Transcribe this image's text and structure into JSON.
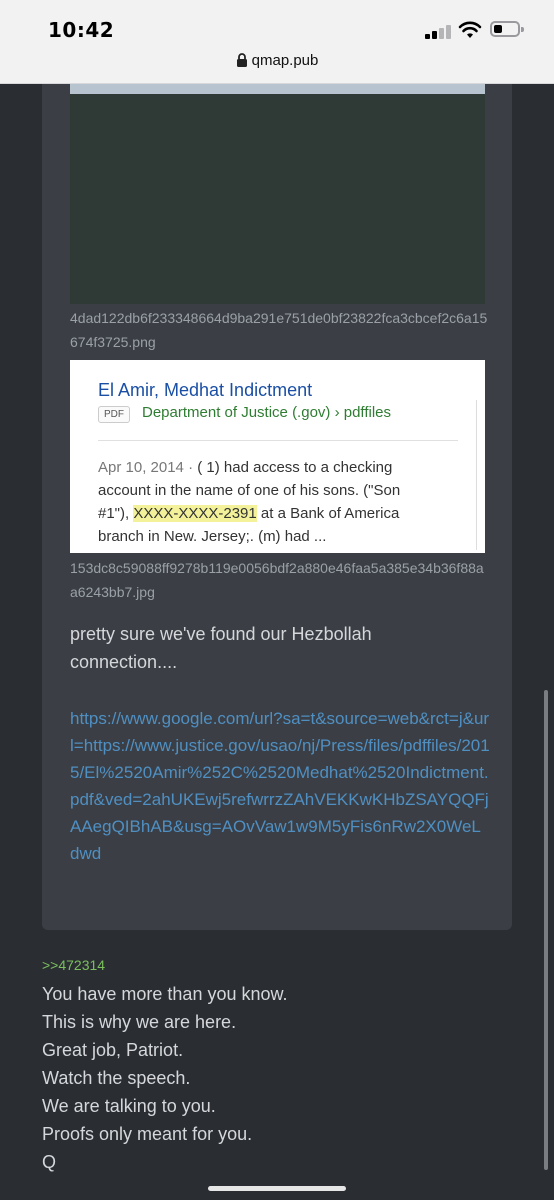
{
  "status_bar": {
    "time": "10:42",
    "url": "qmap.pub"
  },
  "post": {
    "image1_filename": "4dad122db6f233348664d9ba291e751de0bf23822fca3cbcef2c6a15674f3725.png",
    "image2": {
      "title": "El Amir, Medhat Indictment",
      "badge": "PDF",
      "source": "Department of Justice (.gov) › pdffiles",
      "date": "Apr 10, 2014 · ",
      "snippet_before": "( 1) had access to a checking account in the name of one of his sons. (\"Son #1\"), ",
      "snippet_highlight": "XXXX-XXXX-2391",
      "snippet_after": " at a Bank of America branch in New. Jersey;. (m) had ..."
    },
    "image2_filename": "153dc8c59088ff9278b119e0056bdf2a880e46faa5a385e34b36f88aa6243bb7.jpg",
    "comment": "pretty sure we've found our Hezbollah connection....",
    "link": "https://www.google.com/url?sa=t&source=web&rct=j&url=https://www.justice.gov/usao/nj/Press/files/pdffiles/2015/El%2520Amir%252C%2520Medhat%2520Indictment.pdf&ved=2ahUKEwj5refwrrzZAhVEKKwKHbZSAYQQFjAAegQIBhAB&usg=AOvVaw1w9M5yFis6nRw2X0WeLdwd"
  },
  "reply": {
    "quote_ref": ">>472314",
    "lines": [
      "You have more than you know.",
      "This is why we are here.",
      "Great job, Patriot.",
      "Watch the speech.",
      "We are talking to you.",
      "Proofs only meant for you.",
      "Q"
    ]
  },
  "colors": {
    "background": "#2a2e33",
    "card": "#3b3f45",
    "link": "#4f8fc2",
    "quote": "#7bbf5e"
  },
  "icons": [
    "signal-icon",
    "wifi-icon",
    "battery-icon",
    "lock-icon"
  ]
}
